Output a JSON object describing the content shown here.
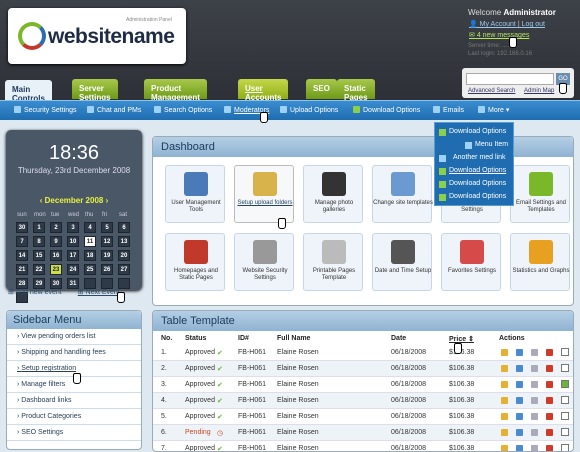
{
  "header": {
    "logo_text": "websitename",
    "logo_sub": "Administration Panel",
    "welcome": "Welcome",
    "user": "Administrator",
    "my_account": "My Account",
    "log_out": "Log out",
    "messages": "4 new messages",
    "server_time": "Server time: ... AM",
    "last_login": "Last login: 192.168.0.16"
  },
  "search": {
    "placeholder": "",
    "go": "GO",
    "advanced": "Advanced Search",
    "admin_map": "Admin Map"
  },
  "tabs": [
    "Main Controls",
    "Server Settings",
    "Product Management",
    "User Accounts",
    "SEO",
    "Static Pages"
  ],
  "subnav": [
    "Security Settings",
    "Chat and PMs",
    "Search Options",
    "Moderators",
    "Upload Options",
    "Download Options",
    "Emails",
    "More"
  ],
  "dropdown": [
    "Download Options",
    "Menu Item",
    "Another med link",
    "Download Options",
    "Download Options",
    "Download Options"
  ],
  "calendar": {
    "time": "18:36",
    "date": "Thursday, 23rd December 2008",
    "month": "December 2008",
    "dows": [
      "sun",
      "mon",
      "tue",
      "wed",
      "thu",
      "fri",
      "sat"
    ],
    "days": [
      "30",
      "1",
      "2",
      "3",
      "4",
      "5",
      "6",
      "7",
      "8",
      "9",
      "10",
      "11",
      "12",
      "13",
      "14",
      "15",
      "16",
      "17",
      "18",
      "19",
      "20",
      "21",
      "22",
      "23",
      "24",
      "25",
      "26",
      "27",
      "28",
      "29",
      "30",
      "31",
      "",
      "",
      "",
      ""
    ],
    "add_event": "Add new event",
    "next_event": "Next Event"
  },
  "sidebar": {
    "title": "Sidebar Menu",
    "items": [
      "View pending orders list",
      "Shipping and handling fees",
      "Setup registration",
      "Manage filters",
      "Dashboard links",
      "Product Categories",
      "SEO Settings"
    ]
  },
  "dashboard": {
    "title": "Dashboard",
    "tiles": [
      "User Management Tools",
      "Setup upload folders",
      "Manage photo galleries",
      "Change site templates",
      "SEO Tools and Settings",
      "Email Settings and Templates",
      "Homepages and Static Pages",
      "Website Security Settings",
      "Printable Pages Template",
      "Date and Time Setup",
      "Favorites Settings",
      "Statistics and Graphs"
    ]
  },
  "table": {
    "title": "Table Template",
    "headers": [
      "No.",
      "Status",
      "ID#",
      "Full Name",
      "Date",
      "Price",
      "Actions"
    ],
    "rows": [
      [
        "1.",
        "Approved",
        "FB-H061",
        "Elaine Rosen",
        "06/18/2008",
        "$106.38"
      ],
      [
        "2.",
        "Approved",
        "FB-H061",
        "Elaine Rosen",
        "06/18/2008",
        "$106.38"
      ],
      [
        "3.",
        "Approved",
        "FB-H061",
        "Elaine Rosen",
        "06/18/2008",
        "$106.38"
      ],
      [
        "4.",
        "Approved",
        "FB-H061",
        "Elaine Rosen",
        "06/18/2008",
        "$106.38"
      ],
      [
        "5.",
        "Approved",
        "FB-H061",
        "Elaine Rosen",
        "06/18/2008",
        "$106.38"
      ],
      [
        "6.",
        "Pending",
        "FB-H061",
        "Elaine Rosen",
        "06/18/2008",
        "$106.38"
      ],
      [
        "7.",
        "Approved",
        "FB-H061",
        "Elaine Rosen",
        "06/18/2008",
        "$106.38"
      ]
    ]
  },
  "colors": {
    "accent_green": "#7ab82a",
    "nav_blue": "#1f6db0",
    "panel_dark": "#4a5766"
  }
}
